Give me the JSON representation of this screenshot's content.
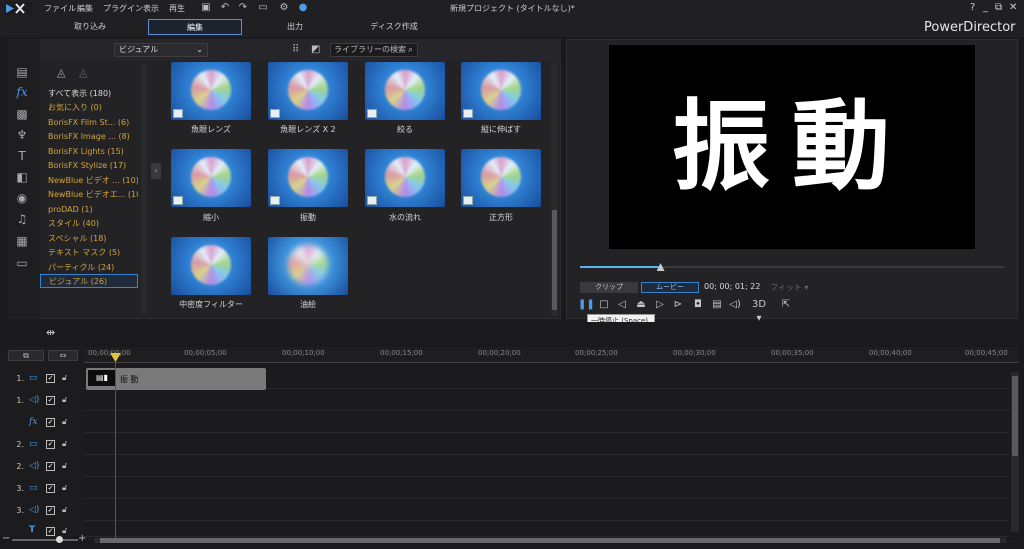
{
  "menu": [
    "ファイル",
    "編集",
    "プラグイン",
    "表示",
    "再生"
  ],
  "window_title": "新規プロジェクト (タイトルなし)*",
  "window_controls": [
    "?",
    "_",
    "⧉",
    "✕"
  ],
  "modes": {
    "capture": "取り込み",
    "edit": "編集",
    "output": "出力",
    "disc": "ディスク作成"
  },
  "brand": "PowerDirector",
  "library": {
    "view_select": "ビジュアル",
    "search_placeholder": "ライブラリーの検索",
    "categories": [
      "すべて表示 (180)",
      "お気に入り (0)",
      "BorisFX Film St... (6)",
      "BorisFX Image ... (8)",
      "BorisFX Lights (15)",
      "BorisFX Stylize (17)",
      "NewBlue ビデオ ... (10)",
      "NewBlue ビデオエ... (10)",
      "proDAD (1)",
      "スタイル (40)",
      "スペシャル (18)",
      "テキスト マスク (5)",
      "パーティクル (24)",
      "ビジュアル (26)"
    ],
    "effects": [
      "魚眼レンズ",
      "魚眼レンズ X 2",
      "絞る",
      "縦に伸ばす",
      "縮小",
      "振動",
      "水の流れ",
      "正方形",
      "中密度フィルター",
      "油絵"
    ]
  },
  "preview": {
    "text": "振動",
    "clip_label": "クリップ",
    "movie_label": "ムービー",
    "timecode": "00; 00; 01; 22",
    "fit": "フィット",
    "stereo": "3D",
    "tooltip": "一時停止 (Space)",
    "progress": 0.19
  },
  "timeline": {
    "ruler": [
      "00;00;00;00",
      "00;00;05;00",
      "00;00;10;00",
      "00;00;15;00",
      "00;00;20;00",
      "00;00;25;00",
      "00;00;30;00",
      "00;00;35;00",
      "00;00;40;00",
      "00;00;45;00"
    ],
    "tracks": [
      {
        "label": "1.",
        "type": "video"
      },
      {
        "label": "1.",
        "type": "audio"
      },
      {
        "label": "",
        "type": "fx"
      },
      {
        "label": "2.",
        "type": "video"
      },
      {
        "label": "2.",
        "type": "audio"
      },
      {
        "label": "3.",
        "type": "video"
      },
      {
        "label": "3.",
        "type": "audio"
      },
      {
        "label": "",
        "type": "title"
      }
    ],
    "clip_name": "振 動"
  },
  "colors": {
    "accent": "#4d9ae6",
    "category_text": "#d4a33c",
    "playhead": "#d02020"
  }
}
